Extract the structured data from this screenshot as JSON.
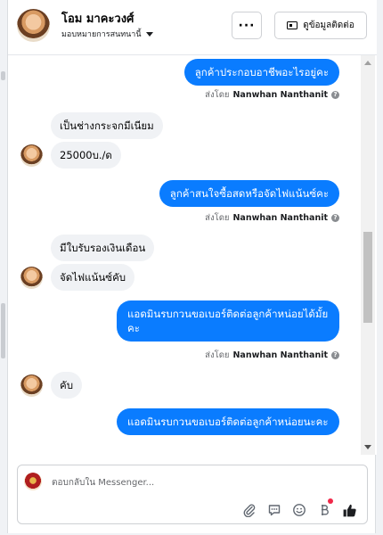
{
  "header": {
    "contact_name": "โอม มาคะวงศ์",
    "assign_label": "มอบหมายการสนทนานี้",
    "more_label": "···",
    "contact_button_label": "ดูข้อมูลติดต่อ"
  },
  "messages": [
    {
      "direction": "out",
      "text": "ลูกค้าประกอบอาชีพอะไรอยู่คะ"
    },
    {
      "direction": "in",
      "text": "เป็นช่างกระจกมีเนียม"
    },
    {
      "direction": "in",
      "text": "25000บ./ด"
    },
    {
      "direction": "out",
      "text": "ลูกค้าสนใจซื้อสดหรือจัดไฟแน้นซ์คะ"
    },
    {
      "direction": "in",
      "text": "มีใบรับรองเงินเดือน"
    },
    {
      "direction": "in",
      "text": "จัดไฟแน้นซ์คับ"
    },
    {
      "direction": "out",
      "text": "แอดมินรบกวนขอเบอร์ติดต่อลูกค้าหน่อยได้มั้ยคะ"
    },
    {
      "direction": "in",
      "text": "คับ"
    },
    {
      "direction": "out",
      "text": "แอดมินรบกวนขอเบอร์ติดต่อลูกค้าหน่อยนะคะ"
    }
  ],
  "sent_by": {
    "prefix": "ส่งโดย",
    "name": "Nanwhan Nanthanit",
    "help_icon": "?"
  },
  "composer": {
    "placeholder": "ตอบกลับใน Messenger..."
  },
  "icons": {
    "attach": "paperclip-icon",
    "saved_replies": "speech-bubble-icon",
    "emoji": "emoji-icon",
    "payment": "baht-icon",
    "like": "thumbs-up-icon"
  },
  "colors": {
    "outgoing_bubble": "#0a7cff",
    "incoming_bubble": "#f0f2f5",
    "notification_dot": "#f02849"
  }
}
